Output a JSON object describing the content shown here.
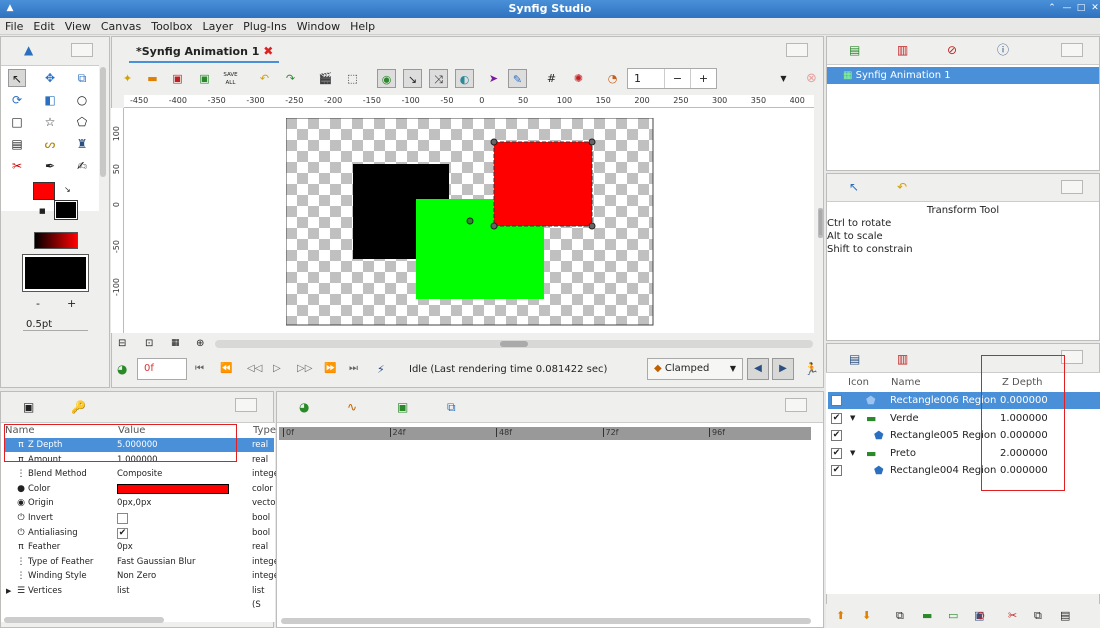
{
  "app": {
    "title": "Synfig Studio",
    "window_buttons": [
      "⌃",
      "—",
      "□",
      "✕"
    ]
  },
  "menu": [
    "File",
    "Edit",
    "View",
    "Canvas",
    "Toolbox",
    "Layer",
    "Plug-Ins",
    "Window",
    "Help"
  ],
  "canvas_tab": {
    "label": "*Synfig Animation 1"
  },
  "toolbar": {
    "save_all": "SAVE ALL",
    "frame_value": "1",
    "minus": "−",
    "plus": "+"
  },
  "ruler": {
    "h_labels": [
      "-450",
      "-400",
      "-350",
      "-300",
      "-250",
      "-200",
      "-150",
      "-100",
      "-50",
      "0",
      "50",
      "100",
      "150",
      "200",
      "250",
      "300",
      "350",
      "400"
    ],
    "v_labels": [
      "100",
      "50",
      "0",
      "-50",
      "-100"
    ]
  },
  "toolbox_widgets": {
    "minus": "-",
    "plus": "+",
    "width": "0.5pt"
  },
  "timebar": {
    "frame": "0f",
    "status": "Idle (Last rendering time 0.081422 sec)",
    "interpolation": "Clamped"
  },
  "canvas_browser": {
    "item": "Synfig Animation 1"
  },
  "tool_options": {
    "title": "Transform Tool",
    "hints": [
      "Ctrl to rotate",
      "Alt to scale",
      "Shift to constrain"
    ]
  },
  "params": {
    "headers": [
      "Name",
      "Value",
      "Type"
    ],
    "rows": [
      {
        "icon": "π",
        "name": "Z Depth",
        "value": "5.000000",
        "type": "real",
        "selected": true
      },
      {
        "icon": "π",
        "name": "Amount",
        "value": "1.000000",
        "type": "real"
      },
      {
        "icon": "⋮",
        "name": "Blend Method",
        "value": "Composite",
        "type": "integer"
      },
      {
        "icon": "●",
        "name": "Color",
        "value": "",
        "type": "color",
        "swatch": "#ff0000"
      },
      {
        "icon": "◉",
        "name": "Origin",
        "value": "0px,0px",
        "type": "vector"
      },
      {
        "icon": "⏻",
        "name": "Invert",
        "value": "",
        "type": "bool",
        "check": false
      },
      {
        "icon": "⏻",
        "name": "Antialiasing",
        "value": "",
        "type": "bool",
        "check": true
      },
      {
        "icon": "π",
        "name": "Feather",
        "value": "0px",
        "type": "real"
      },
      {
        "icon": "⋮",
        "name": "Type of Feather",
        "value": "Fast Gaussian Blur",
        "type": "integer"
      },
      {
        "icon": "⋮",
        "name": "Winding Style",
        "value": "Non Zero",
        "type": "integer"
      },
      {
        "icon": "☰",
        "name": "Vertices",
        "value": "list",
        "type": "list (S"
      }
    ]
  },
  "timetrack": {
    "marks": [
      "0f",
      "24f",
      "48f",
      "72f",
      "96f"
    ]
  },
  "layers": {
    "headers": [
      "Icon",
      "Name",
      "Z Depth"
    ],
    "rows": [
      {
        "name": "Rectangle006 Region",
        "z": "0.000000",
        "type": "region",
        "expander": false,
        "indent": 0,
        "selected": true
      },
      {
        "name": "Verde",
        "z": "1.000000",
        "type": "group",
        "expander": true,
        "indent": 0
      },
      {
        "name": "Rectangle005 Region",
        "z": "0.000000",
        "type": "region",
        "expander": false,
        "indent": 1
      },
      {
        "name": "Preto",
        "z": "2.000000",
        "type": "group",
        "expander": true,
        "indent": 0
      },
      {
        "name": "Rectangle004 Region",
        "z": "0.000000",
        "type": "region",
        "expander": false,
        "indent": 1
      }
    ]
  },
  "colors": {
    "selection": "#4a90d9",
    "highlight_box": "#e02020",
    "rect_black": "#000000",
    "rect_green": "#00ff00",
    "rect_red": "#ff0000",
    "outline_color": "#ff0000",
    "fill_color": "#000000"
  }
}
